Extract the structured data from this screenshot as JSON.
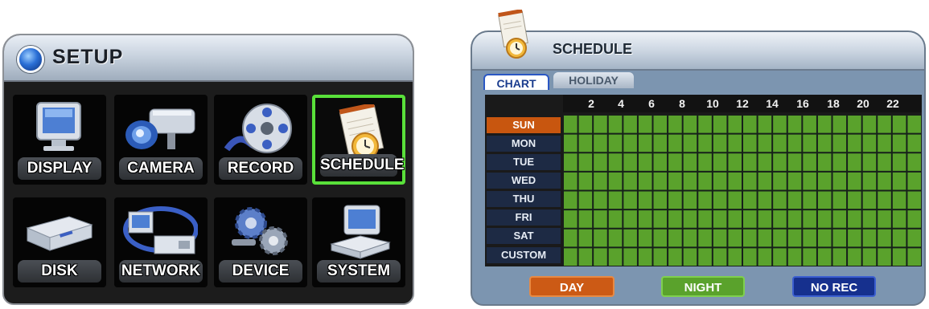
{
  "setup": {
    "title": "SETUP",
    "tiles": [
      {
        "label": "DISPLAY",
        "icon": "monitor-icon"
      },
      {
        "label": "CAMERA",
        "icon": "camera-icon"
      },
      {
        "label": "RECORD",
        "icon": "film-reel-icon"
      },
      {
        "label": "SCHEDULE",
        "icon": "schedule-clock-icon",
        "selected": true
      },
      {
        "label": "DISK",
        "icon": "disk-drive-icon"
      },
      {
        "label": "NETWORK",
        "icon": "network-icon"
      },
      {
        "label": "DEVICE",
        "icon": "gears-icon"
      },
      {
        "label": "SYSTEM",
        "icon": "computer-icon"
      }
    ]
  },
  "schedule": {
    "title": "SCHEDULE",
    "tabs": [
      "CHART",
      "HOLIDAY"
    ],
    "active_tab": "CHART",
    "hours": [
      "2",
      "4",
      "6",
      "8",
      "10",
      "12",
      "14",
      "16",
      "18",
      "20",
      "22"
    ],
    "days": [
      "SUN",
      "MON",
      "TUE",
      "WED",
      "THU",
      "FRI",
      "SAT",
      "CUSTOM"
    ],
    "selected_day": "SUN",
    "legend": [
      "DAY",
      "NIGHT",
      "NO REC"
    ],
    "cell_state": "NIGHT"
  },
  "colors": {
    "day": "#cc5a15",
    "night": "#5aa22c",
    "no_rec": "#16308e",
    "selection": "#59e03a"
  }
}
